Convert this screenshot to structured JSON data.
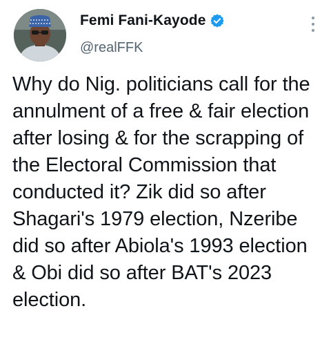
{
  "author": {
    "display_name": "Femi Fani-Kayode",
    "handle": "@realFFK",
    "verified": true,
    "verified_color": "#1d9bf0"
  },
  "tweet": {
    "text": "Why do Nig. politicians call for the annulment of a free & fair election after losing & for the scrapping of the Electoral Commission that conducted it? Zik did so after Shagari's 1979 election, Nzeribe did so after Abiola's 1993 election & Obi did so after BAT's 2023 election."
  },
  "icons": {
    "verified": "verified-badge-icon",
    "more": "more-options-icon"
  }
}
